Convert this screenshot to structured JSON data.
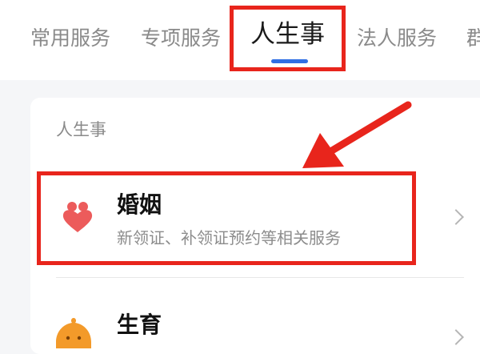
{
  "tabs": [
    {
      "label": "常用服务",
      "active": false
    },
    {
      "label": "专项服务",
      "active": false
    },
    {
      "label": "人生事",
      "active": true
    },
    {
      "label": "法人服务",
      "active": false
    },
    {
      "label": "群",
      "active": false
    }
  ],
  "section": {
    "title": "人生事"
  },
  "items": [
    {
      "title": "婚姻",
      "desc": "新领证、补领证预约等相关服务",
      "icon": "heart-icon"
    },
    {
      "title": "生育",
      "desc": "",
      "icon": "baby-icon"
    }
  ],
  "colors": {
    "accent": "#2f6fe4",
    "annotation": "#e8251c",
    "heart": "#ec5b5b",
    "baby": "#f39a2a"
  }
}
